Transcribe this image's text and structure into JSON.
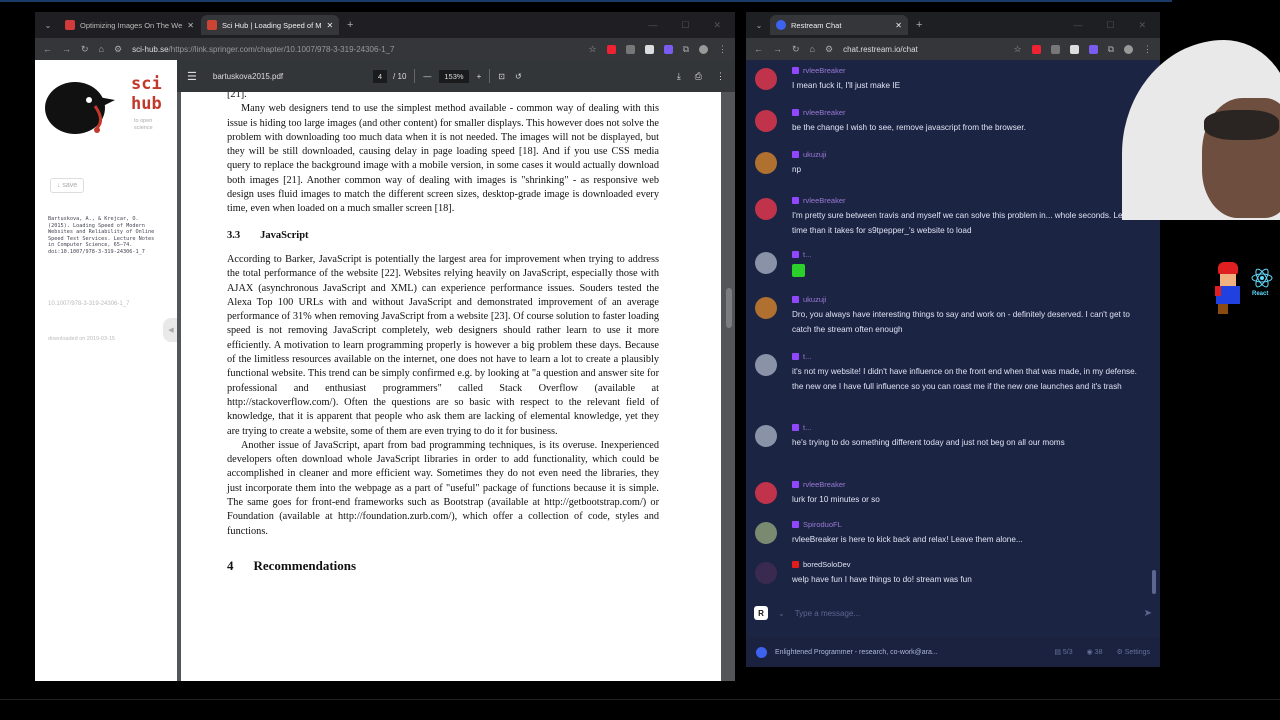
{
  "left_window": {
    "tabs": [
      {
        "title": "Optimizing Images On The We",
        "active": false
      },
      {
        "title": "Sci Hub | Loading Speed of M",
        "active": true
      }
    ],
    "url_host": "sci-hub.se",
    "url_path": "/https://link.springer.com/chapter/10.1007/978-3-319-24306-1_7"
  },
  "scihub": {
    "logo_line1": "sci",
    "logo_line2": "hub",
    "tagline": "to open science",
    "save_label": "↓ save",
    "citation": "Bartuskova, A., & Krejcar, O. (2015). Loading Speed of Modern Websites and Reliability of Online Speed Test Services. Lecture Notes in Computer Science, 65–74. doi:10.1007/978-3-319-24306-1_7",
    "doi": "10.1007/978-3-319-24306-1_7",
    "downloaded": "downloaded on 2019-03-15"
  },
  "pdf": {
    "filename": "bartuskova2015.pdf",
    "page_current": "4",
    "page_total": "/ 10",
    "zoom": "153%",
    "top_ref": "[21].",
    "p1": "Many web designers tend to use the simplest method available - common way of dealing with this issue is hiding too large images (and other content) for smaller displays. This however does not solve the problem with downloading too much data when it is not needed. The images will not be displayed, but they will be still downloaded, causing delay in page loading speed [18]. And if you use CSS media query to replace the background image with a mobile version, in some cases it would actually download both images [21]. Another common way of dealing with images is \"shrinking\" - as responsive web design uses fluid images to match the different screen sizes, desktop-grade image is downloaded every time, even when loaded on a much smaller screen [18].",
    "section_num": "3.3",
    "section_title": "JavaScript",
    "p2": "According to Barker, JavaScript is potentially the largest area for improvement when trying to address the total performance of the website [22]. Websites relying heavily on JavaScript, especially those with AJAX (asynchronous JavaScript and XML) can experience performance issues. Souders tested the Alexa Top 100 URLs with and without JavaScript and demonstrated improvement of an average performance of 31% when removing JavaScript from a website [23]. Of course solution to faster loading speed is not removing JavaScript completely, web designers should rather learn to use it more efficiently. A motivation to learn programming properly is however a big problem these days. Because of the limitless resources available on the internet, one does not have to learn a lot to create a plausibly functional website. This trend can be simply confirmed e.g. by looking at \"a question and answer site for professional and enthusiast programmers\" called Stack Overflow (available at http://stackoverflow.com/). Often the questions are so basic with respect to the relevant field of knowledge, that it is apparent that people who ask them are lacking of elemental knowledge, yet they are trying to create a website, some of them are even trying to do it for business.",
    "p3": "Another issue of JavaScript, apart from bad programming techniques, is its overuse. Inexperienced developers often download whole JavaScript libraries in order to add functionality, which could be accomplished in cleaner and more efficient way. Sometimes they do not even need the libraries, they just incorporate them into the webpage as a part of \"useful\" package of functions because it is simple. The same goes for front-end frameworks such as Bootstrap (available at http://getbootstrap.com/) or Foundation (available at http://foundation.zurb.com/), which offer a collection of code, styles and functions.",
    "section4_num": "4",
    "section4_title": "Recommendations"
  },
  "right_window": {
    "tab_title": "Restream Chat",
    "url": "chat.restream.io/chat"
  },
  "chat": {
    "messages": [
      {
        "user": "rvleeBreaker",
        "text": "I mean fuck it, I'll just make IE",
        "avatar": "#c0334a"
      },
      {
        "user": "rvleeBreaker",
        "text": "be the change I wish to see, remove javascript from the browser.",
        "avatar": "#c0334a"
      },
      {
        "user": "ukuzuji",
        "text": "np",
        "avatar": "#b07030"
      },
      {
        "user": "rvleeBreaker",
        "text": "I'm pretty sure between travis and myself we can solve this problem in... whole seconds. Less time than it takes for s9tpepper_'s website to load",
        "avatar": "#c0334a"
      },
      {
        "user": "t...",
        "text": "",
        "avatar": "#8a92a8"
      },
      {
        "user": "ukuzuji",
        "text": "Dro, you always have interesting things to say and work on - definitely deserved. I can't get to catch the stream often enough",
        "avatar": "#b07030"
      },
      {
        "user": "t...",
        "text": "it's not my website! I didn't have influence on the front end when that was made, in my defense. the new one I have full influence so you can roast me if the new one launches and it's trash",
        "avatar": "#8a92a8"
      },
      {
        "user": "t...",
        "text": "he's trying to do something different today and just not beg on all our moms",
        "avatar": "#8a92a8"
      },
      {
        "user": "rvleeBreaker",
        "text": "lurk for 10 minutes or so",
        "avatar": "#c0334a"
      },
      {
        "user": "SpiroduoFL",
        "text": "rvleeBreaker is here to kick back and relax! Leave them alone...",
        "avatar": "#7a8a70"
      },
      {
        "user": "boredSoloDev",
        "text": "welp have fun I have things to do! stream was fun",
        "avatar": "#3a2a50"
      }
    ],
    "input_placeholder": "Type a message...",
    "footer_title": "Enlightened Programmer - research, co-work@ara...",
    "footer_count1": "5/3",
    "footer_count2": "38",
    "footer_settings": "Settings"
  },
  "overlay": {
    "react_label": "React"
  }
}
